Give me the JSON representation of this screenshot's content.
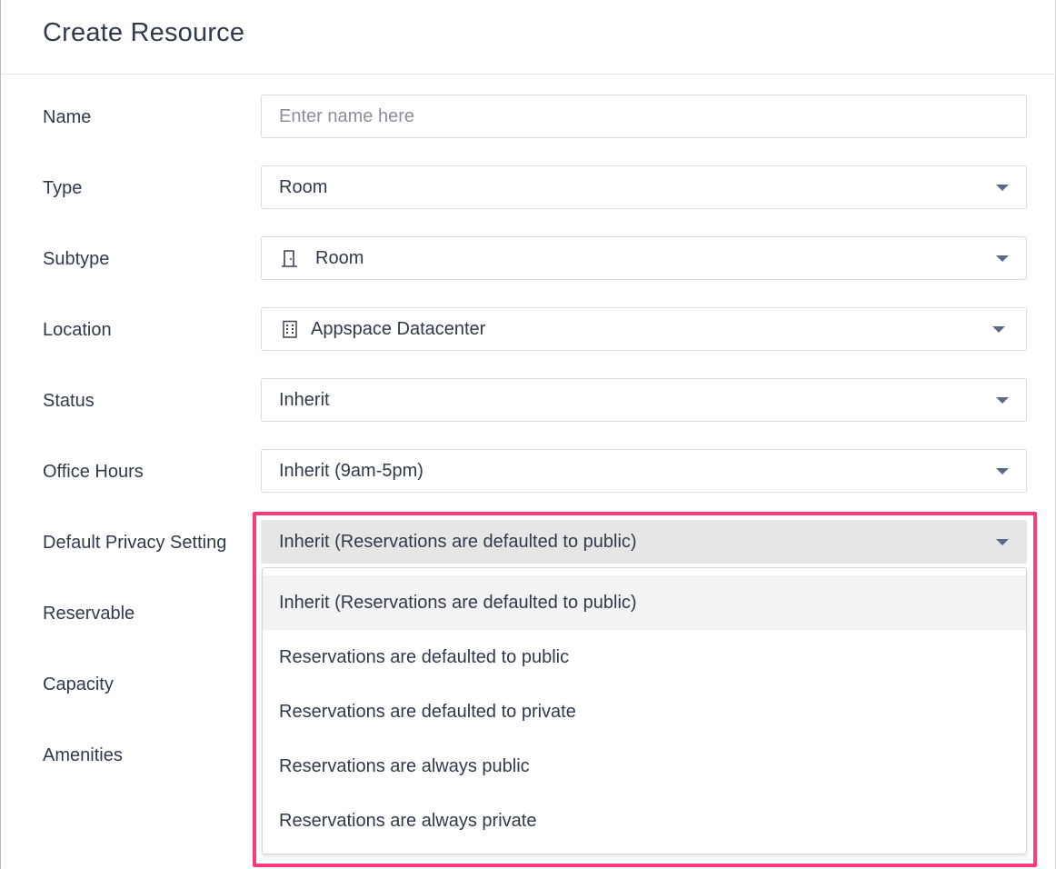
{
  "dialog": {
    "title": "Create Resource"
  },
  "form": {
    "name": {
      "label": "Name",
      "placeholder": "Enter name here",
      "value": ""
    },
    "type": {
      "label": "Type",
      "value": "Room"
    },
    "subtype": {
      "label": "Subtype",
      "value": "Room",
      "icon": "door-icon"
    },
    "location": {
      "label": "Location",
      "value": "Appspace Datacenter",
      "icon": "building-icon"
    },
    "status": {
      "label": "Status",
      "value": "Inherit"
    },
    "office_hours": {
      "label": "Office Hours",
      "value": "Inherit (9am-5pm)"
    },
    "privacy": {
      "label": "Default Privacy Setting",
      "value": "Inherit (Reservations are defaulted to public)",
      "options": [
        "Inherit (Reservations are defaulted to public)",
        "Reservations are defaulted to public",
        "Reservations are defaulted to private",
        "Reservations are always public",
        "Reservations are always private"
      ],
      "selected_index": 0
    },
    "reservable": {
      "label": "Reservable"
    },
    "capacity": {
      "label": "Capacity"
    },
    "amenities": {
      "label": "Amenities"
    }
  },
  "colors": {
    "highlight": "#ff3b7b",
    "text": "#2f3a4b",
    "caret": "#5b6a8a",
    "active_field": "#e6e6e6"
  }
}
